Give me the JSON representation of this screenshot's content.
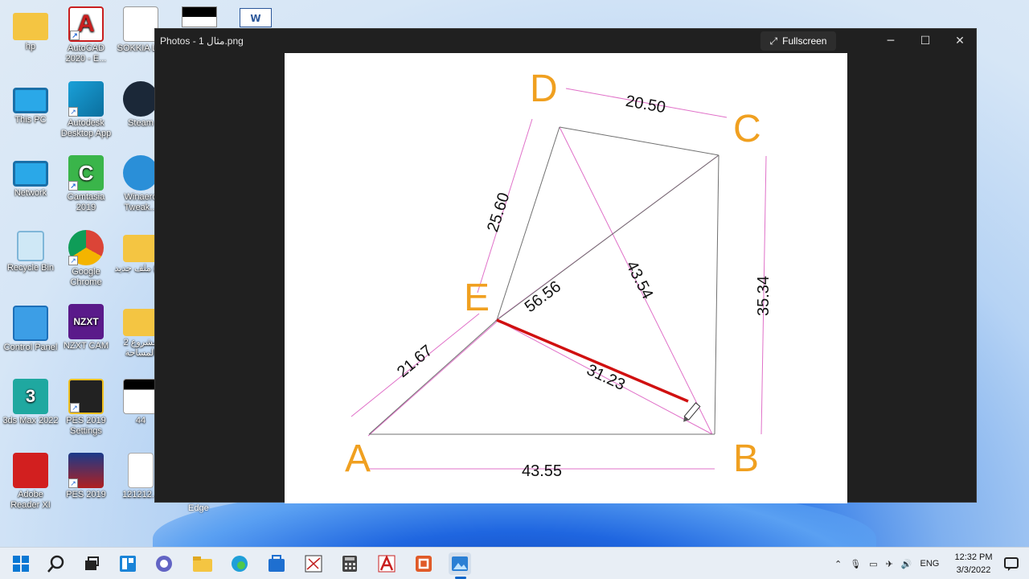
{
  "desktop": {
    "icons": [
      {
        "label": "hp"
      },
      {
        "label": "AutoCAD 2020 - E..."
      },
      {
        "label": "SOKKIA L..."
      },
      {
        "label": "This PC"
      },
      {
        "label": "Autodesk Desktop App"
      },
      {
        "label": "Steam"
      },
      {
        "label": "Network"
      },
      {
        "label": "Camtasia 2019"
      },
      {
        "label": "Winaero Tweak..."
      },
      {
        "label": "Recycle Bin"
      },
      {
        "label": "Google Chrome"
      },
      {
        "label": "ملف جديد (...)"
      },
      {
        "label": "Control Panel"
      },
      {
        "label": "NZXT CAM"
      },
      {
        "label": "2 مشروع المساحة"
      },
      {
        "label": "3ds Max 2022"
      },
      {
        "label": "PES 2019 Settings"
      },
      {
        "label": "44"
      },
      {
        "label": "Adobe Reader XI"
      },
      {
        "label": "PES 2019"
      },
      {
        "label": "121212..."
      }
    ],
    "partial_label": "Edge"
  },
  "window": {
    "title": "Photos - 1 مثال.png",
    "fullscreen_label": "Fullscreen"
  },
  "figure": {
    "points": {
      "A": "A",
      "B": "B",
      "C": "C",
      "D": "D",
      "E": "E"
    },
    "measurements": {
      "dc": "20.50",
      "de": "25.60",
      "ec": "56.56",
      "db": "43.54",
      "cb": "35.34",
      "ae": "21.67",
      "eb": "31.23",
      "ab": "43.55"
    },
    "colors": {
      "point_label": "#f0a020",
      "dimension_line": "#e070c8",
      "highlight": "#d01010",
      "edge": "#707070"
    }
  },
  "taskbar": {
    "language": "ENG",
    "time": "12:32 PM",
    "date": "3/3/2022"
  }
}
